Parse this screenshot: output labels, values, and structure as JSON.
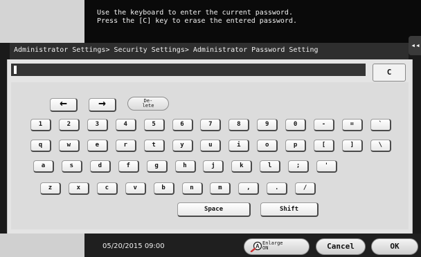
{
  "message": {
    "line1": "Use the keyboard to enter the current password.",
    "line2": "Press the [C] key to erase the entered password."
  },
  "side_tab": {
    "glyph": "◂◂"
  },
  "breadcrumb": "Administrator Settings> Security Settings> Administrator Password Setting",
  "password_field": {
    "value": ""
  },
  "clear_button": {
    "label": "C"
  },
  "keyboard": {
    "arrow_left": "←",
    "arrow_right": "→",
    "delete_line1": "De-",
    "delete_line2": "lete",
    "row1": [
      "1",
      "2",
      "3",
      "4",
      "5",
      "6",
      "7",
      "8",
      "9",
      "0",
      "-",
      "=",
      "`"
    ],
    "row2": [
      "q",
      "w",
      "e",
      "r",
      "t",
      "y",
      "u",
      "i",
      "o",
      "p",
      "[",
      "]",
      "\\"
    ],
    "row3": [
      "a",
      "s",
      "d",
      "f",
      "g",
      "h",
      "j",
      "k",
      "l",
      ";",
      "'"
    ],
    "row4": [
      "z",
      "x",
      "c",
      "v",
      "b",
      "n",
      "m",
      ",",
      ".",
      "/"
    ],
    "space": "Space",
    "shift": "Shift"
  },
  "status": {
    "datetime": "05/20/2015  09:00"
  },
  "buttons": {
    "enlarge_line1": "Enlarge",
    "enlarge_line2": "ON",
    "enlarge_icon": "magnify-a-icon",
    "cancel": "Cancel",
    "ok": "OK"
  }
}
